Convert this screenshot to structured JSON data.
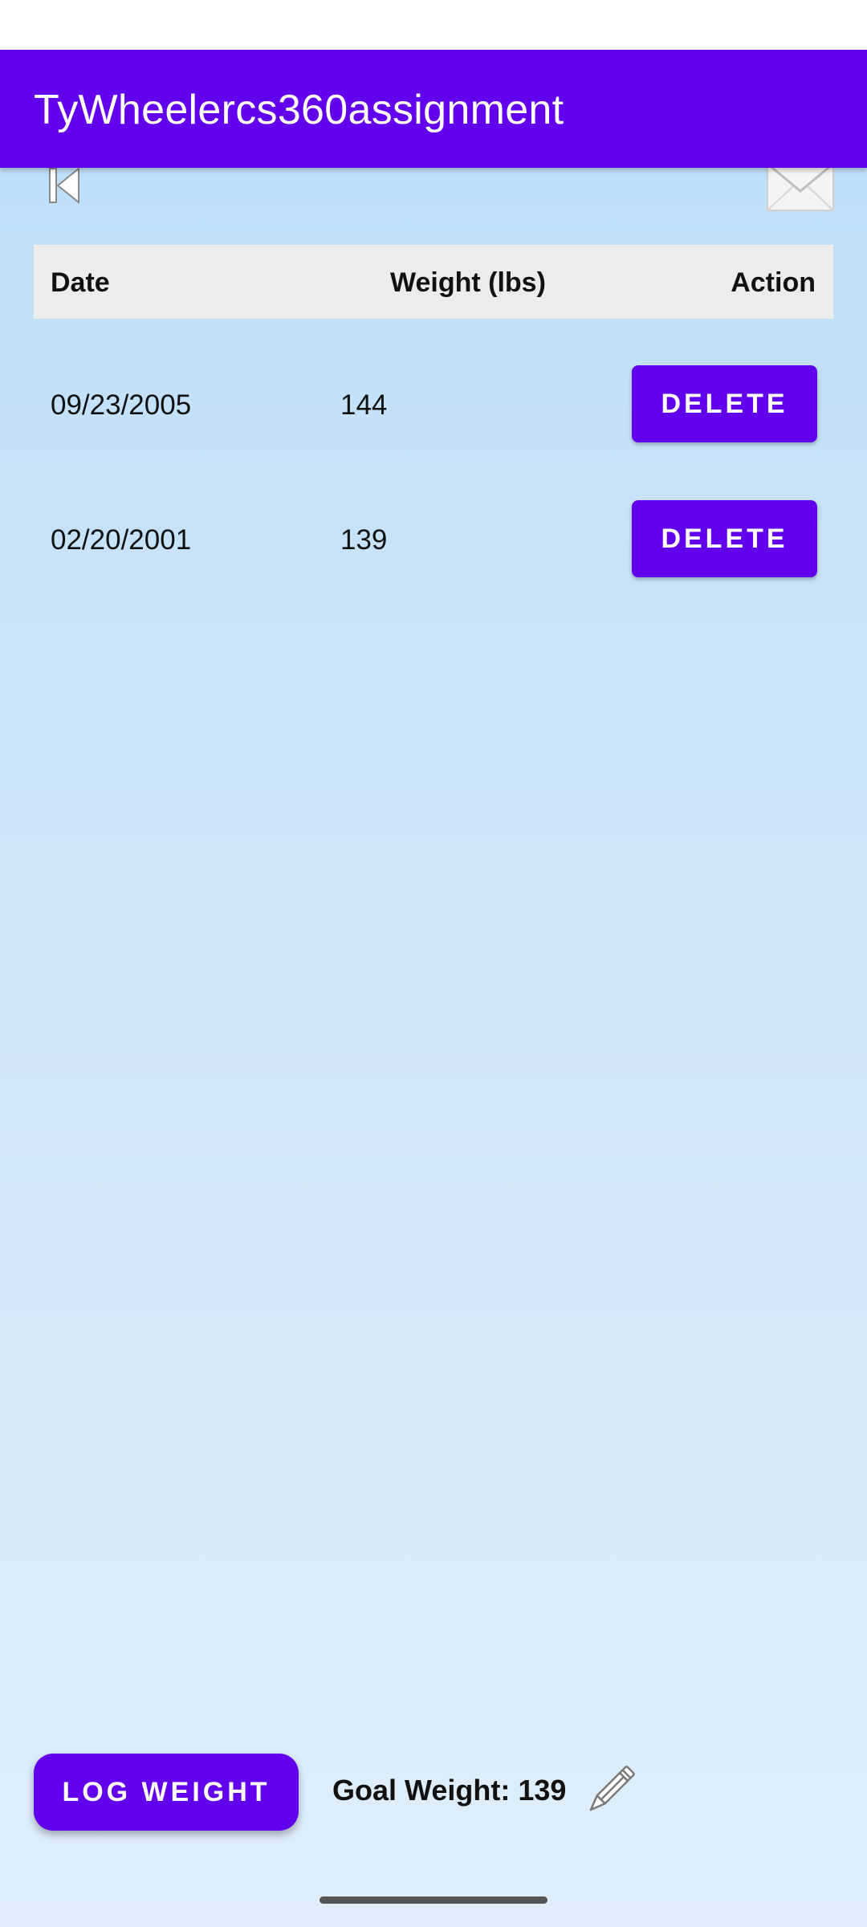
{
  "app": {
    "title": "TyWheelercs360assignment",
    "accent_color": "#6200ee"
  },
  "toolbar": {
    "back_icon": "skip-previous-icon",
    "mail_icon": "mail-envelope-icon"
  },
  "table": {
    "headers": {
      "date": "Date",
      "weight": "Weight (lbs)",
      "action": "Action"
    },
    "rows": [
      {
        "date": "09/23/2005",
        "weight": "144",
        "action_label": "DELETE"
      },
      {
        "date": "02/20/2001",
        "weight": "139",
        "action_label": "DELETE"
      }
    ]
  },
  "footer": {
    "log_button_label": "LOG WEIGHT",
    "goal_label": "Goal Weight: 139",
    "edit_icon": "pencil-icon"
  }
}
